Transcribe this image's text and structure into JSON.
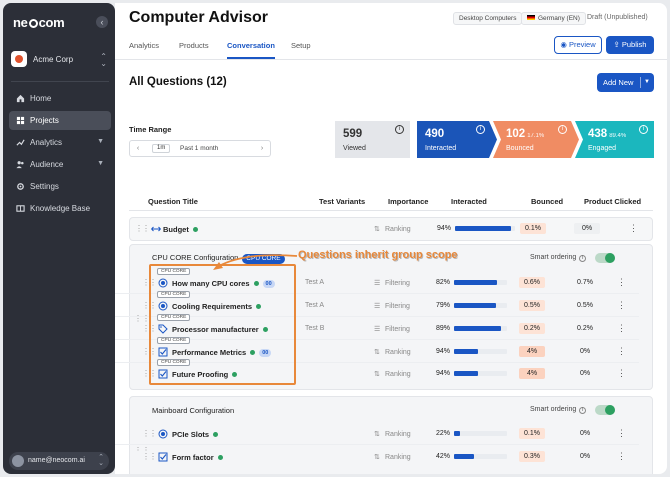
{
  "sidebar": {
    "logo": {
      "prefix": "ne",
      "suffix": "com"
    },
    "org": {
      "name": "Acme Corp"
    },
    "nav": [
      {
        "label": "Home",
        "icon": "home-icon"
      },
      {
        "label": "Projects",
        "icon": "grid-icon",
        "active": true
      },
      {
        "label": "Analytics",
        "icon": "chart-icon",
        "expandable": true
      },
      {
        "label": "Audience",
        "icon": "users-icon",
        "expandable": true
      },
      {
        "label": "Settings",
        "icon": "gear-icon"
      },
      {
        "label": "Knowledge Base",
        "icon": "book-icon"
      }
    ],
    "user": {
      "email": "name@neocom.ai"
    }
  },
  "header": {
    "title": "Computer Advisor",
    "chip_category": "Desktop Computers",
    "chip_locale": "Germany (EN)",
    "status": "Draft (Unpublished)",
    "tabs": [
      {
        "label": "Analytics"
      },
      {
        "label": "Products"
      },
      {
        "label": "Conversation",
        "active": true
      },
      {
        "label": "Setup"
      }
    ],
    "preview_label": "Preview",
    "publish_label": "Publish"
  },
  "section": {
    "title": "All Questions (12)",
    "add_new_label": "Add New"
  },
  "time_range": {
    "label": "Time Range",
    "pill": "1m",
    "range": "Past 1 month"
  },
  "stats": [
    {
      "value": "599",
      "label": "Viewed",
      "pct": "",
      "color": "#e4e6ea"
    },
    {
      "value": "490",
      "label": "Interacted",
      "pct": "",
      "color": "#1b55b8"
    },
    {
      "value": "102",
      "label": "Bounced",
      "pct": "17.1%",
      "color": "#f08c63"
    },
    {
      "value": "438",
      "label": "Engaged",
      "pct": "89.4%",
      "color": "#1bb7be"
    }
  ],
  "columns": {
    "title": "Question Title",
    "variants": "Test Variants",
    "importance": "Importance",
    "interacted": "Interacted",
    "bounced": "Bounced",
    "clicked": "Product Clicked"
  },
  "budget_row": {
    "title": "Budget",
    "importance": "Ranking",
    "interacted": "94%",
    "interacted_value": 94,
    "bounced": "0.1%",
    "clicked": "0%"
  },
  "groups": [
    {
      "title": "CPU CORE Configuration",
      "badge": "CPU CORE",
      "smart_ordering": "Smart ordering",
      "rows": [
        {
          "tag": "CPU CORE",
          "title": "How many CPU cores",
          "icon": "radio-icon",
          "group_badge": "00",
          "variant": "Test A",
          "importance": "Filtering",
          "interacted": "82%",
          "interacted_value": 82,
          "bounced": "0.6%",
          "clicked": "0.7%"
        },
        {
          "tag": "CPU CORE",
          "title": "Cooling Requirements",
          "icon": "radio-icon",
          "group_badge": "",
          "variant": "Test A",
          "importance": "Filtering",
          "interacted": "79%",
          "interacted_value": 79,
          "bounced": "0.5%",
          "clicked": "0.5%"
        },
        {
          "tag": "CPU CORE",
          "title": "Processor manufacturer",
          "icon": "tag-icon",
          "group_badge": "",
          "variant": "Test B",
          "importance": "Filtering",
          "interacted": "89%",
          "interacted_value": 89,
          "bounced": "0.2%",
          "clicked": "0.2%"
        },
        {
          "tag": "CPU CORE",
          "title": "Performance Metrics",
          "icon": "checkbox-icon",
          "group_badge": "00",
          "variant": "",
          "importance": "Ranking",
          "interacted": "94%",
          "interacted_value": 45,
          "bounced": "4%",
          "clicked": "0%"
        },
        {
          "tag": "CPU CORE",
          "title": "Future Proofing",
          "icon": "checkbox-icon",
          "group_badge": "",
          "variant": "",
          "importance": "Ranking",
          "interacted": "94%",
          "interacted_value": 45,
          "bounced": "4%",
          "clicked": "0%"
        }
      ]
    },
    {
      "title": "Mainboard Configuration",
      "badge": "",
      "smart_ordering": "Smart ordering",
      "rows": [
        {
          "tag": "",
          "title": "PCIe Slots",
          "icon": "radio-icon",
          "group_badge": "",
          "variant": "",
          "importance": "Ranking",
          "interacted": "22%",
          "interacted_value": 12,
          "bounced": "0.1%",
          "clicked": "0%"
        },
        {
          "tag": "",
          "title": "Form factor",
          "icon": "checkbox-icon",
          "group_badge": "",
          "variant": "",
          "importance": "Ranking",
          "interacted": "42%",
          "interacted_value": 38,
          "bounced": "0.3%",
          "clicked": "0%"
        }
      ]
    }
  ],
  "annotation": {
    "callout": "Questions inherit group scope",
    "color": "#e8883a"
  }
}
